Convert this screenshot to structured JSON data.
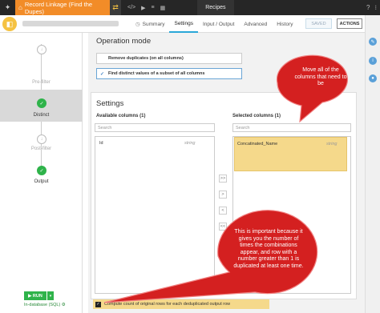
{
  "topbar": {
    "title": "Record Linkage (Find the Dupes)",
    "recipes_label": "Recipes",
    "icons": [
      "bird-logo-icon",
      "flow-icon",
      "code-icon",
      "play-icon",
      "database-icon",
      "grid-icon",
      "help-icon",
      "apps-icon"
    ]
  },
  "subbar": {
    "tabs": [
      {
        "label": "Summary",
        "icon": "summary-icon"
      },
      {
        "label": "Settings"
      },
      {
        "label": "Input / Output"
      },
      {
        "label": "Advanced"
      },
      {
        "label": "History"
      }
    ],
    "saved_label": "SAVED",
    "actions_label": "ACTIONS"
  },
  "steps": [
    {
      "label": "Pre-filter"
    },
    {
      "label": "Distinct"
    },
    {
      "label": "Post-filter"
    },
    {
      "label": "Output"
    }
  ],
  "run": {
    "label": "RUN",
    "engine": "In-database (SQL)"
  },
  "operation_mode": {
    "title": "Operation mode",
    "options": [
      {
        "label": "Remove duplicates (on all columns)"
      },
      {
        "label": "Find distinct values of a subset of all columns"
      }
    ]
  },
  "settings": {
    "title": "Settings",
    "available_title": "Available columns (1)",
    "selected_title": "Selected columns (1)",
    "search_placeholder": "Search",
    "available": [
      {
        "name": "Id",
        "type": "string"
      }
    ],
    "selected": [
      {
        "name": "Concatinated_Name",
        "type": "string"
      }
    ],
    "move_buttons": [
      ">>",
      ">",
      "<",
      "<<"
    ],
    "count_label": "Compute count of original rows for each deduplicated output row"
  },
  "callouts": {
    "top": "Move all of the columns that need to be",
    "bottom": "This is important because it gives you the number of times the combinations appear, and row with a number greater than 1 is duplicated at least one time."
  },
  "colors": {
    "callout_red": "#d42020",
    "accent_orange": "#f28c28",
    "success_green": "#2fb34a",
    "highlight_yellow": "#f5d98b"
  }
}
